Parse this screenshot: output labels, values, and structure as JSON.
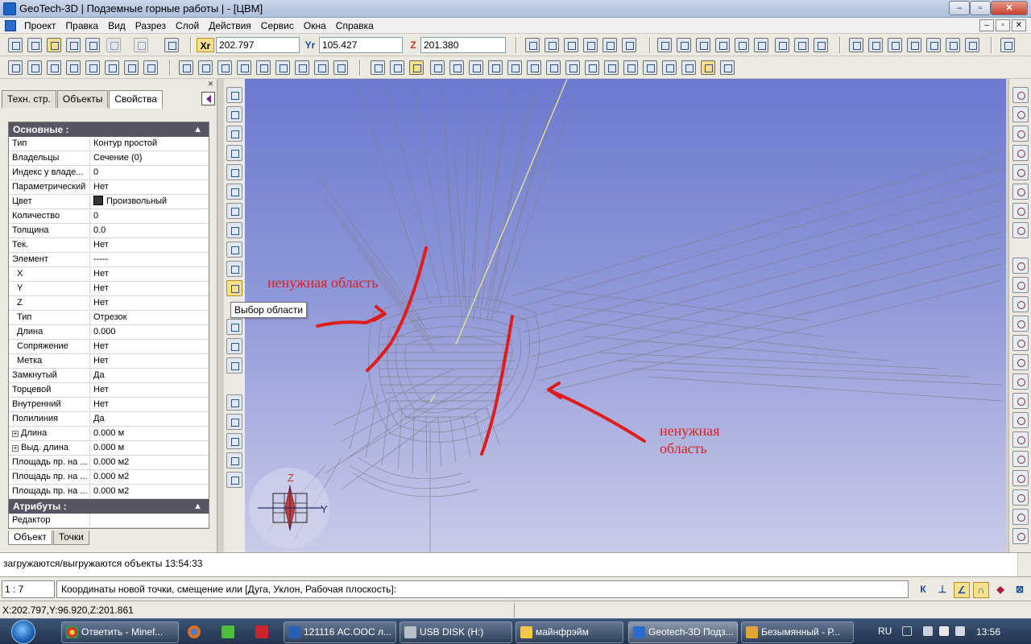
{
  "window": {
    "title": "GeoTech-3D | Подземные горные работы | - [ЦВМ]"
  },
  "menu": [
    "Проект",
    "Правка",
    "Вид",
    "Разрез",
    "Слой",
    "Действия",
    "Сервис",
    "Окна",
    "Справка"
  ],
  "coords": {
    "x_label": "Xr",
    "x_value": "202.797",
    "y_label": "Yr",
    "y_value": "105.427",
    "z_label": "Z",
    "z_value": "201.380"
  },
  "left_panel": {
    "tabs": [
      "Техн. стр.",
      "Объекты",
      "Свойства"
    ],
    "active_tab": "Свойства",
    "group_basic": "Основные :",
    "rows": [
      {
        "k": "Тип",
        "v": "Контур простой"
      },
      {
        "k": "Владельцы",
        "v": "Сечение (0)"
      },
      {
        "k": "Индекс у владе...",
        "v": "0"
      },
      {
        "k": "Параметрический",
        "v": "Нет"
      },
      {
        "k": "Цвет",
        "v": "Произвольный"
      },
      {
        "k": "Количество",
        "v": "0"
      },
      {
        "k": "Толщина",
        "v": "0.0"
      },
      {
        "k": "Тек.",
        "v": "Нет"
      },
      {
        "k": "Элемент",
        "v": "-----"
      },
      {
        "k": "X",
        "v": "Нет"
      },
      {
        "k": "Y",
        "v": "Нет"
      },
      {
        "k": "Z",
        "v": "Нет"
      },
      {
        "k": "Тип",
        "v": "Отрезок"
      },
      {
        "k": "Длина",
        "v": "0.000"
      },
      {
        "k": "Сопряжение",
        "v": "Нет"
      },
      {
        "k": "Метка",
        "v": "Нет"
      },
      {
        "k": "Замкнутый",
        "v": "Да"
      },
      {
        "k": "Торцевой",
        "v": "Нет"
      },
      {
        "k": "Внутренний",
        "v": "Нет"
      },
      {
        "k": "Полилиния",
        "v": "Да"
      },
      {
        "k": "Длина",
        "v": "0.000 м"
      },
      {
        "k": "Выд. длина",
        "v": "0.000 м"
      },
      {
        "k": "Площадь пр. на ...",
        "v": "0.000 м2"
      },
      {
        "k": "Площадь пр. на ...",
        "v": "0.000 м2"
      },
      {
        "k": "Площадь пр. на ...",
        "v": "0.000 м2"
      }
    ],
    "group_attrs": "Атрибуты :",
    "attr_rows": [
      {
        "k": "Редактор",
        "v": ""
      }
    ],
    "bottom_tabs": [
      "Объект",
      "Точки"
    ]
  },
  "tooltip": "Выбор области",
  "viewport": {
    "annotation_1": "ненужная область",
    "annotation_2_line1": "ненужная",
    "annotation_2_line2": "область",
    "axis_z": "Z",
    "axis_y": "Y"
  },
  "messages": {
    "log": "загружаются/выгружаются объекты 13:54:33"
  },
  "command": {
    "ratio": "1 : 7",
    "prompt": "Координаты новой точки, смещение или [Дуга, Уклон, Рабочая плоскость]:",
    "snap_k": "К"
  },
  "status": {
    "cursor": "X:202.797,Y:96.920,Z:201.861"
  },
  "taskbar": {
    "tasks": [
      "Ответить - Minef...",
      "121116 АС.ООС л...",
      "USB DISK (H:)",
      "майнфрэйм",
      "Geotech-3D Подз...",
      "Безымянный - Р..."
    ],
    "lang": "RU",
    "clock": "13:56"
  }
}
